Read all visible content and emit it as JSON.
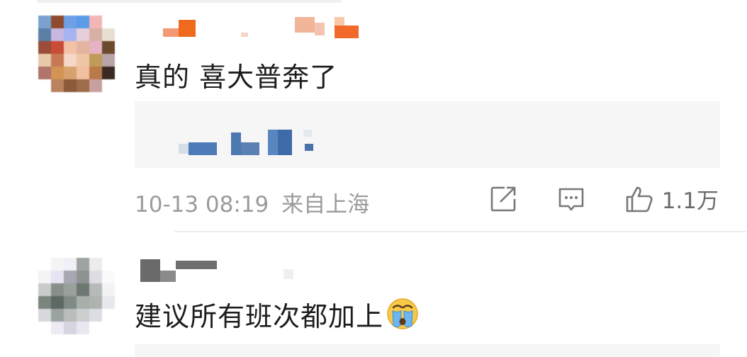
{
  "comments": [
    {
      "content": "真的 喜大普奔了",
      "timestamp": "10-13 08:19",
      "location": "来自上海",
      "like_count": "1.1万"
    },
    {
      "content": "建议所有班次都加上",
      "emoji": "crying-face-emoji"
    }
  ],
  "icons": {
    "share": "share-icon",
    "comment": "comment-icon",
    "like": "thumbs-up-icon"
  },
  "colors": {
    "text": "#1d1d1d",
    "meta": "#9b9b9b",
    "reply_bg": "#f6f6f6",
    "divider": "#ededed"
  }
}
